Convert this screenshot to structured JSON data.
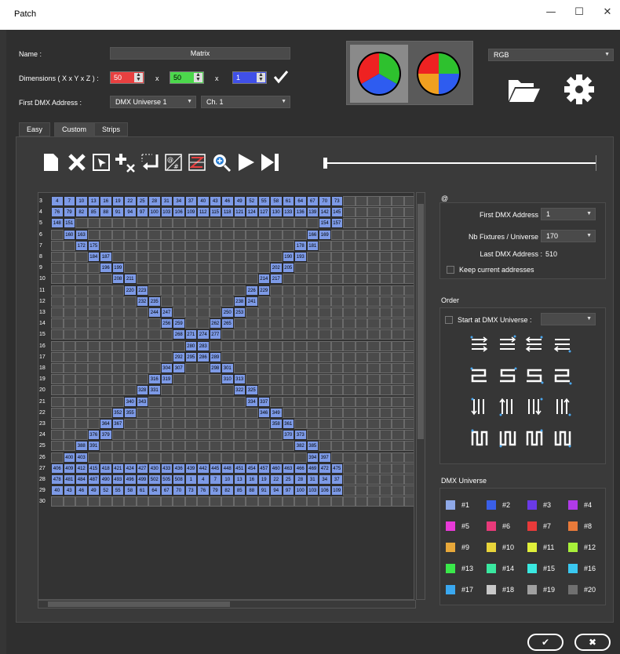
{
  "window": {
    "title": "Patch",
    "minimize": "—",
    "maximize": "☐",
    "close": "✕"
  },
  "name": {
    "label": "Name :",
    "value": "Matrix"
  },
  "dimensions": {
    "label": "Dimensions ( X x Y x Z ) :",
    "x": "50",
    "y": "50",
    "z": "1",
    "sep": "x"
  },
  "first_dmx": {
    "label": "First DMX Address :",
    "universe": "DMX Universe 1",
    "channel": "Ch. 1"
  },
  "color_mode": "RGB",
  "tabs": [
    {
      "label": "Easy"
    },
    {
      "label": "Custom"
    },
    {
      "label": "Strips"
    }
  ],
  "grid": {
    "row_labels": [
      "3",
      "4",
      "5",
      "6",
      "7",
      "8",
      "9",
      "10",
      "11",
      "12",
      "13",
      "14",
      "15",
      "16",
      "17",
      "18",
      "19",
      "20",
      "21",
      "22",
      "23",
      "24",
      "25",
      "26",
      "27",
      "28",
      "29",
      "30"
    ],
    "row3": [
      "4",
      "7",
      "10",
      "13",
      "16",
      "19",
      "22",
      "25",
      "28",
      "31",
      "34",
      "37",
      "40",
      "43",
      "46",
      "49",
      "52",
      "55",
      "58",
      "61",
      "64",
      "67",
      "70",
      "73"
    ],
    "row4": [
      "76",
      "79",
      "82",
      "85",
      "88",
      "91",
      "94",
      "97",
      "100",
      "103",
      "106",
      "109",
      "112",
      "115",
      "118",
      "121",
      "124",
      "127",
      "130",
      "133",
      "136",
      "139",
      "142",
      "145"
    ],
    "row27": [
      "406",
      "409",
      "412",
      "415",
      "418",
      "421",
      "424",
      "427",
      "430",
      "433",
      "436",
      "439",
      "442",
      "445",
      "448",
      "451",
      "454",
      "457",
      "460",
      "463",
      "466",
      "469",
      "472",
      "475"
    ],
    "row28": [
      "478",
      "481",
      "484",
      "487",
      "490",
      "493",
      "496",
      "499",
      "502",
      "505",
      "508",
      "1",
      "4",
      "7",
      "10",
      "13",
      "16",
      "19",
      "22",
      "25",
      "28",
      "31",
      "34",
      "37"
    ],
    "row29": [
      "40",
      "43",
      "46",
      "49",
      "52",
      "55",
      "58",
      "61",
      "64",
      "67",
      "70",
      "73",
      "76",
      "79",
      "82",
      "85",
      "88",
      "91",
      "94",
      "97",
      "100",
      "103",
      "106",
      "109"
    ],
    "diag_left": [
      [
        "148",
        "151"
      ],
      [
        "160",
        "163"
      ],
      [
        "172",
        "175"
      ],
      [
        "184",
        "187"
      ],
      [
        "196",
        "199"
      ],
      [
        "208",
        "211"
      ],
      [
        "220",
        "223"
      ],
      [
        "232",
        "235"
      ],
      [
        "244",
        "247"
      ],
      [
        "256",
        "259"
      ],
      [
        "268",
        "271"
      ],
      [
        "280",
        "283"
      ],
      [
        "286",
        "289"
      ],
      [
        "298",
        "301"
      ],
      [
        "310",
        "313"
      ],
      [
        "322",
        "325"
      ],
      [
        "334",
        "337"
      ],
      [
        "346",
        "349"
      ],
      [
        "358",
        "361"
      ],
      [
        "370",
        "373"
      ],
      [
        "382",
        "385"
      ],
      [
        "394",
        "397"
      ]
    ],
    "diag_right": [
      [
        "154",
        "157"
      ],
      [
        "166",
        "169"
      ],
      [
        "178",
        "181"
      ],
      [
        "190",
        "193"
      ],
      [
        "202",
        "205"
      ],
      [
        "214",
        "217"
      ],
      [
        "226",
        "229"
      ],
      [
        "238",
        "241"
      ],
      [
        "250",
        "253"
      ],
      [
        "262",
        "265"
      ],
      [
        "274",
        "277"
      ],
      [
        "280",
        "283"
      ],
      [
        "292",
        "295"
      ],
      [
        "304",
        "307"
      ],
      [
        "316",
        "319"
      ],
      [
        "328",
        "331"
      ],
      [
        "340",
        "343"
      ],
      [
        "352",
        "355"
      ],
      [
        "364",
        "367"
      ],
      [
        "376",
        "379"
      ],
      [
        "388",
        "391"
      ],
      [
        "400",
        "403"
      ]
    ]
  },
  "settings": {
    "at": "@",
    "first_label": "First DMX Address :",
    "first_value": "1",
    "nb_label": "Nb Fixtures / Universe :",
    "nb_value": "170",
    "last_label": "Last DMX Address :",
    "last_value": "510",
    "keep_label": "Keep current addresses"
  },
  "order": {
    "title": "Order",
    "start_label": "Start at DMX Universe :"
  },
  "universe": {
    "title": "DMX Universe",
    "items": [
      {
        "label": "#1",
        "color": "#8fa9e8"
      },
      {
        "label": "#2",
        "color": "#3a5fe8"
      },
      {
        "label": "#3",
        "color": "#6a3ae8"
      },
      {
        "label": "#4",
        "color": "#b03ae8"
      },
      {
        "label": "#5",
        "color": "#e83ad8"
      },
      {
        "label": "#6",
        "color": "#e83a7a"
      },
      {
        "label": "#7",
        "color": "#e83a3a"
      },
      {
        "label": "#8",
        "color": "#e87a3a"
      },
      {
        "label": "#9",
        "color": "#e8a83a"
      },
      {
        "label": "#10",
        "color": "#e8d43a"
      },
      {
        "label": "#11",
        "color": "#e0f03a"
      },
      {
        "label": "#12",
        "color": "#a8f03a"
      },
      {
        "label": "#13",
        "color": "#3ae84a"
      },
      {
        "label": "#14",
        "color": "#3ae8a0"
      },
      {
        "label": "#15",
        "color": "#3ae8e0"
      },
      {
        "label": "#16",
        "color": "#3ac8f0"
      },
      {
        "label": "#17",
        "color": "#3aa8f0"
      },
      {
        "label": "#18",
        "color": "#c8c8c8"
      },
      {
        "label": "#19",
        "color": "#a0a0a0"
      },
      {
        "label": "#20",
        "color": "#707070"
      }
    ]
  },
  "footer": {
    "ok": "✔",
    "cancel": "✖"
  }
}
